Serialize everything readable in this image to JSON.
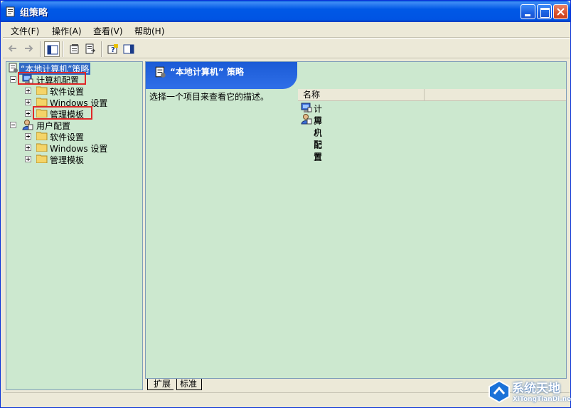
{
  "window": {
    "title": "组策略"
  },
  "menu": {
    "file": "文件(F)",
    "action": "操作(A)",
    "view": "查看(V)",
    "help": "帮助(H)"
  },
  "tree": {
    "root": "“本地计算机”策略",
    "computer_config": "计算机配置",
    "software_settings_1": "软件设置",
    "windows_settings_1": "Windows 设置",
    "admin_templates_1": "管理模板",
    "user_config": "用户配置",
    "software_settings_2": "软件设置",
    "windows_settings_2": "Windows 设置",
    "admin_templates_2": "管理模板"
  },
  "details": {
    "banner_title": "“本地计算机” 策略",
    "description": "选择一个项目来查看它的描述。",
    "column_name": "名称",
    "items": [
      "计算机配置",
      "用户配置"
    ]
  },
  "tabs": {
    "extended": "扩展",
    "standard": "标准"
  },
  "watermark": {
    "title": "系统天地",
    "url": "XiTongTianDi.net"
  }
}
